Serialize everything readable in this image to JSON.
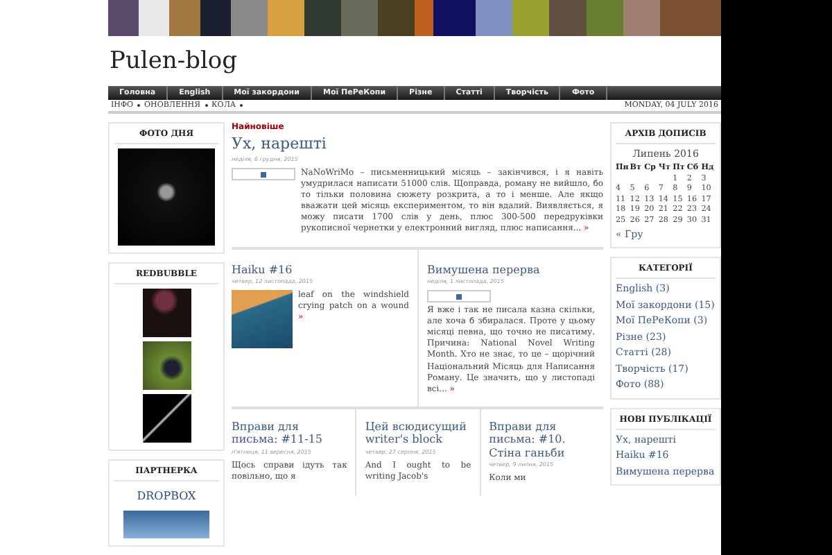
{
  "blog_title": "Pulen-blog",
  "nav": [
    {
      "label": "Головна",
      "selected": false
    },
    {
      "label": "English",
      "selected": false
    },
    {
      "label": "Мої закордони",
      "selected": false
    },
    {
      "label": "Мої ПеРеКопи",
      "selected": false
    },
    {
      "label": "Різне",
      "selected": false
    },
    {
      "label": "Статті",
      "selected": false
    },
    {
      "label": "Творчість",
      "selected": false
    },
    {
      "label": "Фото",
      "selected": false
    }
  ],
  "subnav": [
    "ІНФО",
    "ОНОВЛЕННЯ",
    "КОЛА"
  ],
  "date": "MONDAY, 04 JULY 2016",
  "left_sidebar": [
    {
      "kind": "photo",
      "title": "ФОТО ДНЯ"
    },
    {
      "kind": "gallery",
      "title": "REDBUBBLE",
      "photos": [
        {
          "kind": "flower"
        },
        {
          "kind": "berries"
        },
        {
          "kind": "branch"
        }
      ]
    },
    {
      "kind": "link",
      "title": "ПАРТНЕРКА",
      "link": "DROPBOX"
    }
  ],
  "section_label": "Найновіше",
  "featured": {
    "title": "Ух, нарешті",
    "date": "неділя, 6 грудня, 2015",
    "kind": "broken-image",
    "excerpt": "NaNoWriMo – письменницький місяць – закінчився, і я навіть умудрилася написати 51000 слів. Щоправда, роману не вийшло, бо то тільки половина сюжету розкрита, а то і менше. Але якщо вважати цей місяць експериментом, то він вдалий. Виявляється, я можу писати 1700 слів у день, плюс 300-500 передруківки рукописної чернетки у електронний вигляд, плюс написання...",
    "more": "»"
  },
  "posts_row_1": [
    {
      "title": "Haiku #16",
      "date": "четвер, 12 листопада, 2015",
      "kind": "photo",
      "excerpt": "leaf on the windshield crying patch on a wound",
      "more": "»"
    },
    {
      "title": "Вимушена перерва",
      "date": "неділя, 1 листопада, 2015",
      "kind": "broken-image",
      "excerpt": "Я вже і так не писала казна скільки, але хоча б збиралася. Проте у цьому місяці певна, що точно не писатиму. Причина: National Novel Writing Month. Хто не знає, то це – щорічний Національний Місяць для Написання Роману. Це значить, що у листопаді всі...",
      "more": "»"
    }
  ],
  "posts_row_2": [
    {
      "title": "Вправи для письма: #11-15",
      "date": "п'ятниця, 11 вересня, 2015",
      "excerpt": "Щось справи ідуть так повільно, що я"
    },
    {
      "title": "Цей всюдисущий writer's block",
      "date": "четвер, 27 серпня, 2015",
      "excerpt": "And I ought to be writing Jacob's"
    },
    {
      "title": "Вправи для письма: #10. Стіна ганьби",
      "date": "четвер, 9 липня, 2015",
      "excerpt": "Коли ми"
    }
  ],
  "archive": {
    "title": "АРХІВ ДОПИСІВ",
    "month": "Липень 2016",
    "weekdays": [
      "Пн",
      "Вт",
      "Ср",
      "Чт",
      "Пт",
      "Сб",
      "Нд"
    ],
    "weeks": [
      [
        "1",
        "2",
        "3"
      ],
      [
        "4",
        "5",
        "6",
        "7",
        "8",
        "9",
        "10"
      ],
      [
        "11",
        "12",
        "13",
        "14",
        "15",
        "16",
        "17"
      ],
      [
        "18",
        "19",
        "20",
        "21",
        "22",
        "23",
        "24"
      ],
      [
        "25",
        "26",
        "27",
        "28",
        "29",
        "30",
        "31"
      ]
    ],
    "prev": "« Гру"
  },
  "categories": {
    "title": "КАТЕГОРІЇ",
    "items": [
      {
        "name": "English",
        "count": "(3)"
      },
      {
        "name": "Мої закордони",
        "count": "(15)"
      },
      {
        "name": "Мої ПеРеКопи",
        "count": "(3)"
      },
      {
        "name": "Різне",
        "count": "(23)"
      },
      {
        "name": "Статті",
        "count": "(28)"
      },
      {
        "name": "Творчість",
        "count": "(17)"
      },
      {
        "name": "Фото",
        "count": "(88)"
      }
    ]
  },
  "recent": {
    "title": "НОВІ ПУБЛІКАЦІЇ",
    "items": [
      "Ух, нарешті",
      "Haiku #16",
      "Вимушена перерва"
    ]
  }
}
